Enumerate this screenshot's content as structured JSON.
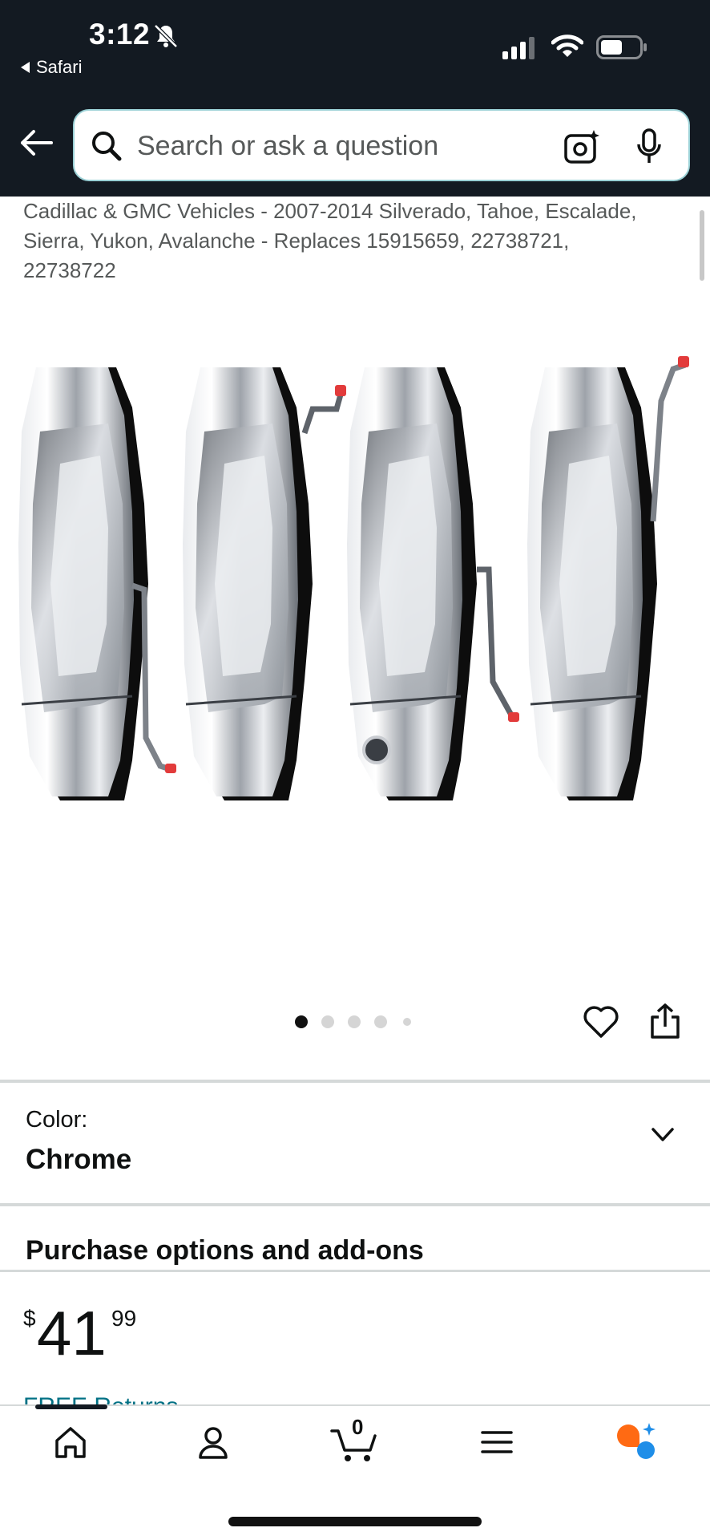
{
  "status_bar": {
    "time": "3:12",
    "back_app": "Safari"
  },
  "search": {
    "placeholder": "Search or ask a question"
  },
  "product": {
    "title_fragment": "Cadillac & GMC Vehicles - 2007-2014 Silverado, Tahoe, Escalade, Sierra, Yukon, Avalanche - Replaces 15915659, 22738721, 22738722",
    "image_alt": "Four chrome exterior door handles",
    "image_count": 5,
    "active_image_index": 0
  },
  "variation": {
    "label": "Color:",
    "value": "Chrome"
  },
  "purchase_options": {
    "heading": "Purchase options and add-ons"
  },
  "price": {
    "symbol": "$",
    "whole": "41",
    "fraction": "99"
  },
  "returns": {
    "label": "FREE Returns"
  },
  "bottom_nav": {
    "cart_count": "0",
    "items": [
      "home-icon",
      "account-icon",
      "cart-icon",
      "menu-icon",
      "rufus-ai-icon"
    ]
  },
  "colors": {
    "header_bg": "#131a22",
    "search_border": "#9bd1d6",
    "link": "#007185",
    "rufus_orange": "#ff6a13",
    "rufus_blue": "#1f8ee8"
  }
}
